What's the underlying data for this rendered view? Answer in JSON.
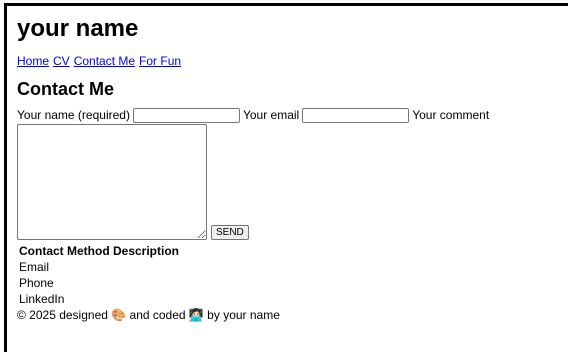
{
  "site": {
    "title": "your name"
  },
  "nav": {
    "items": [
      "Home",
      "CV",
      "Contact Me",
      "For Fun"
    ]
  },
  "page": {
    "heading": "Contact Me"
  },
  "form": {
    "name_label": "Your name (required)",
    "name_value": "",
    "email_label": "Your email",
    "email_value": "",
    "comment_label": "Your comment",
    "comment_value": "",
    "submit_label": "SEND"
  },
  "contacts": {
    "header": "Contact Method Description",
    "items": [
      "Email",
      "Phone",
      "LinkedIn"
    ]
  },
  "footer": {
    "text": "© 2025 designed 🎨 and coded 👩🏻‍💻 by your name"
  }
}
